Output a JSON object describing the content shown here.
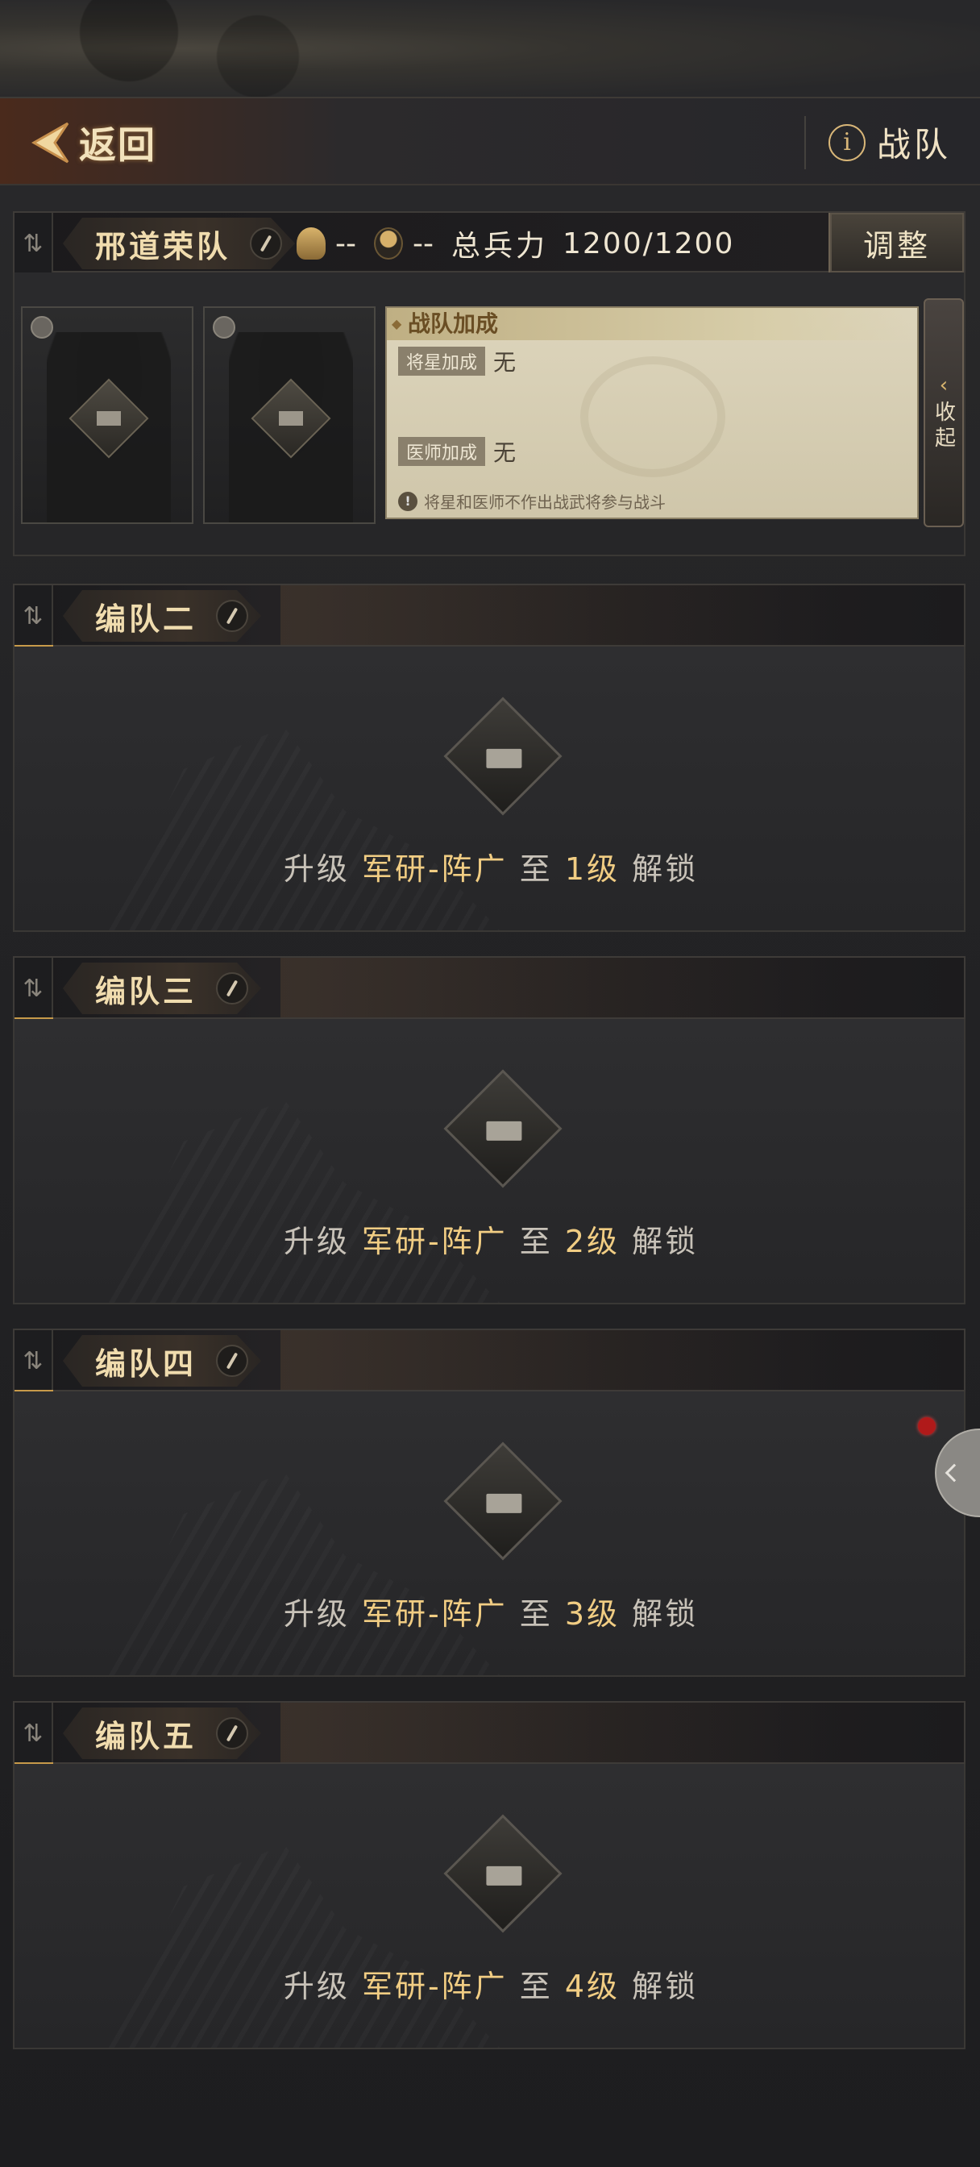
{
  "header": {
    "back_label": "返回",
    "team_info_label": "战队"
  },
  "team1": {
    "name": "邢道荣队",
    "general_value": "--",
    "doctor_value": "--",
    "troops_label": "总兵力",
    "troops_value": "1200/1200",
    "adjust_label": "调整",
    "bonus": {
      "title": "战队加成",
      "star_label": "将星加成",
      "star_value": "无",
      "doctor_label": "医师加成",
      "doctor_value": "无",
      "note": "将星和医师不作出战武将参与战斗"
    },
    "collapse_label": "收起"
  },
  "teams": [
    {
      "name": "编队二",
      "unlock_prefix": "升级",
      "unlock_item": "军研-阵广",
      "unlock_mid": "至",
      "unlock_level": "1级",
      "unlock_suffix": "解锁"
    },
    {
      "name": "编队三",
      "unlock_prefix": "升级",
      "unlock_item": "军研-阵广",
      "unlock_mid": "至",
      "unlock_level": "2级",
      "unlock_suffix": "解锁"
    },
    {
      "name": "编队四",
      "unlock_prefix": "升级",
      "unlock_item": "军研-阵广",
      "unlock_mid": "至",
      "unlock_level": "3级",
      "unlock_suffix": "解锁"
    },
    {
      "name": "编队五",
      "unlock_prefix": "升级",
      "unlock_item": "军研-阵广",
      "unlock_mid": "至",
      "unlock_level": "4级",
      "unlock_suffix": "解锁"
    }
  ],
  "colors": {
    "accent_gold": "#f1cd83",
    "notification_red": "#b01a1a"
  },
  "icons": [
    "back-arrow-icon",
    "info-icon",
    "sort-icon",
    "edit-pen-icon",
    "general-icon",
    "doctor-icon",
    "lock-icon",
    "chevron-left-icon"
  ]
}
